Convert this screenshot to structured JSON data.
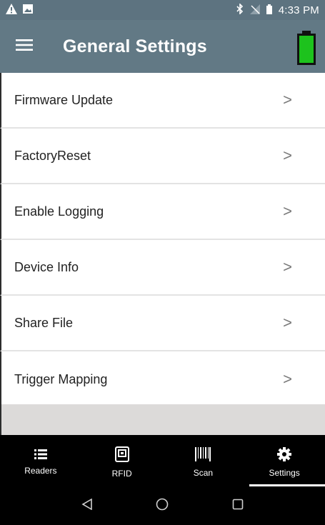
{
  "status_bar": {
    "time": "4:33 PM",
    "icons": [
      "warning-icon",
      "image-icon",
      "bluetooth-icon",
      "no-signal-icon",
      "battery-icon"
    ]
  },
  "app_bar": {
    "title": "General Settings",
    "menu_icon": "hamburger-menu-icon",
    "battery_level": 1.0,
    "battery_color": "#1dc21d"
  },
  "settings": {
    "items": [
      {
        "label": "Firmware Update"
      },
      {
        "label": "FactoryReset"
      },
      {
        "label": "Enable Logging"
      },
      {
        "label": "Device Info"
      },
      {
        "label": "Share File"
      },
      {
        "label": "Trigger Mapping"
      }
    ],
    "chevron": ">"
  },
  "bottom_nav": {
    "tabs": [
      {
        "label": "Readers",
        "icon": "list-icon"
      },
      {
        "label": "RFID",
        "icon": "rfid-icon"
      },
      {
        "label": "Scan",
        "icon": "barcode-icon"
      },
      {
        "label": "Settings",
        "icon": "gear-icon"
      }
    ],
    "active_tab": "Settings"
  },
  "system_nav": {
    "icons": [
      "back-icon",
      "home-icon",
      "recents-icon"
    ]
  },
  "colors": {
    "app_bar": "#627985",
    "status_bar": "#5d7380",
    "nav_background": "#000000"
  }
}
